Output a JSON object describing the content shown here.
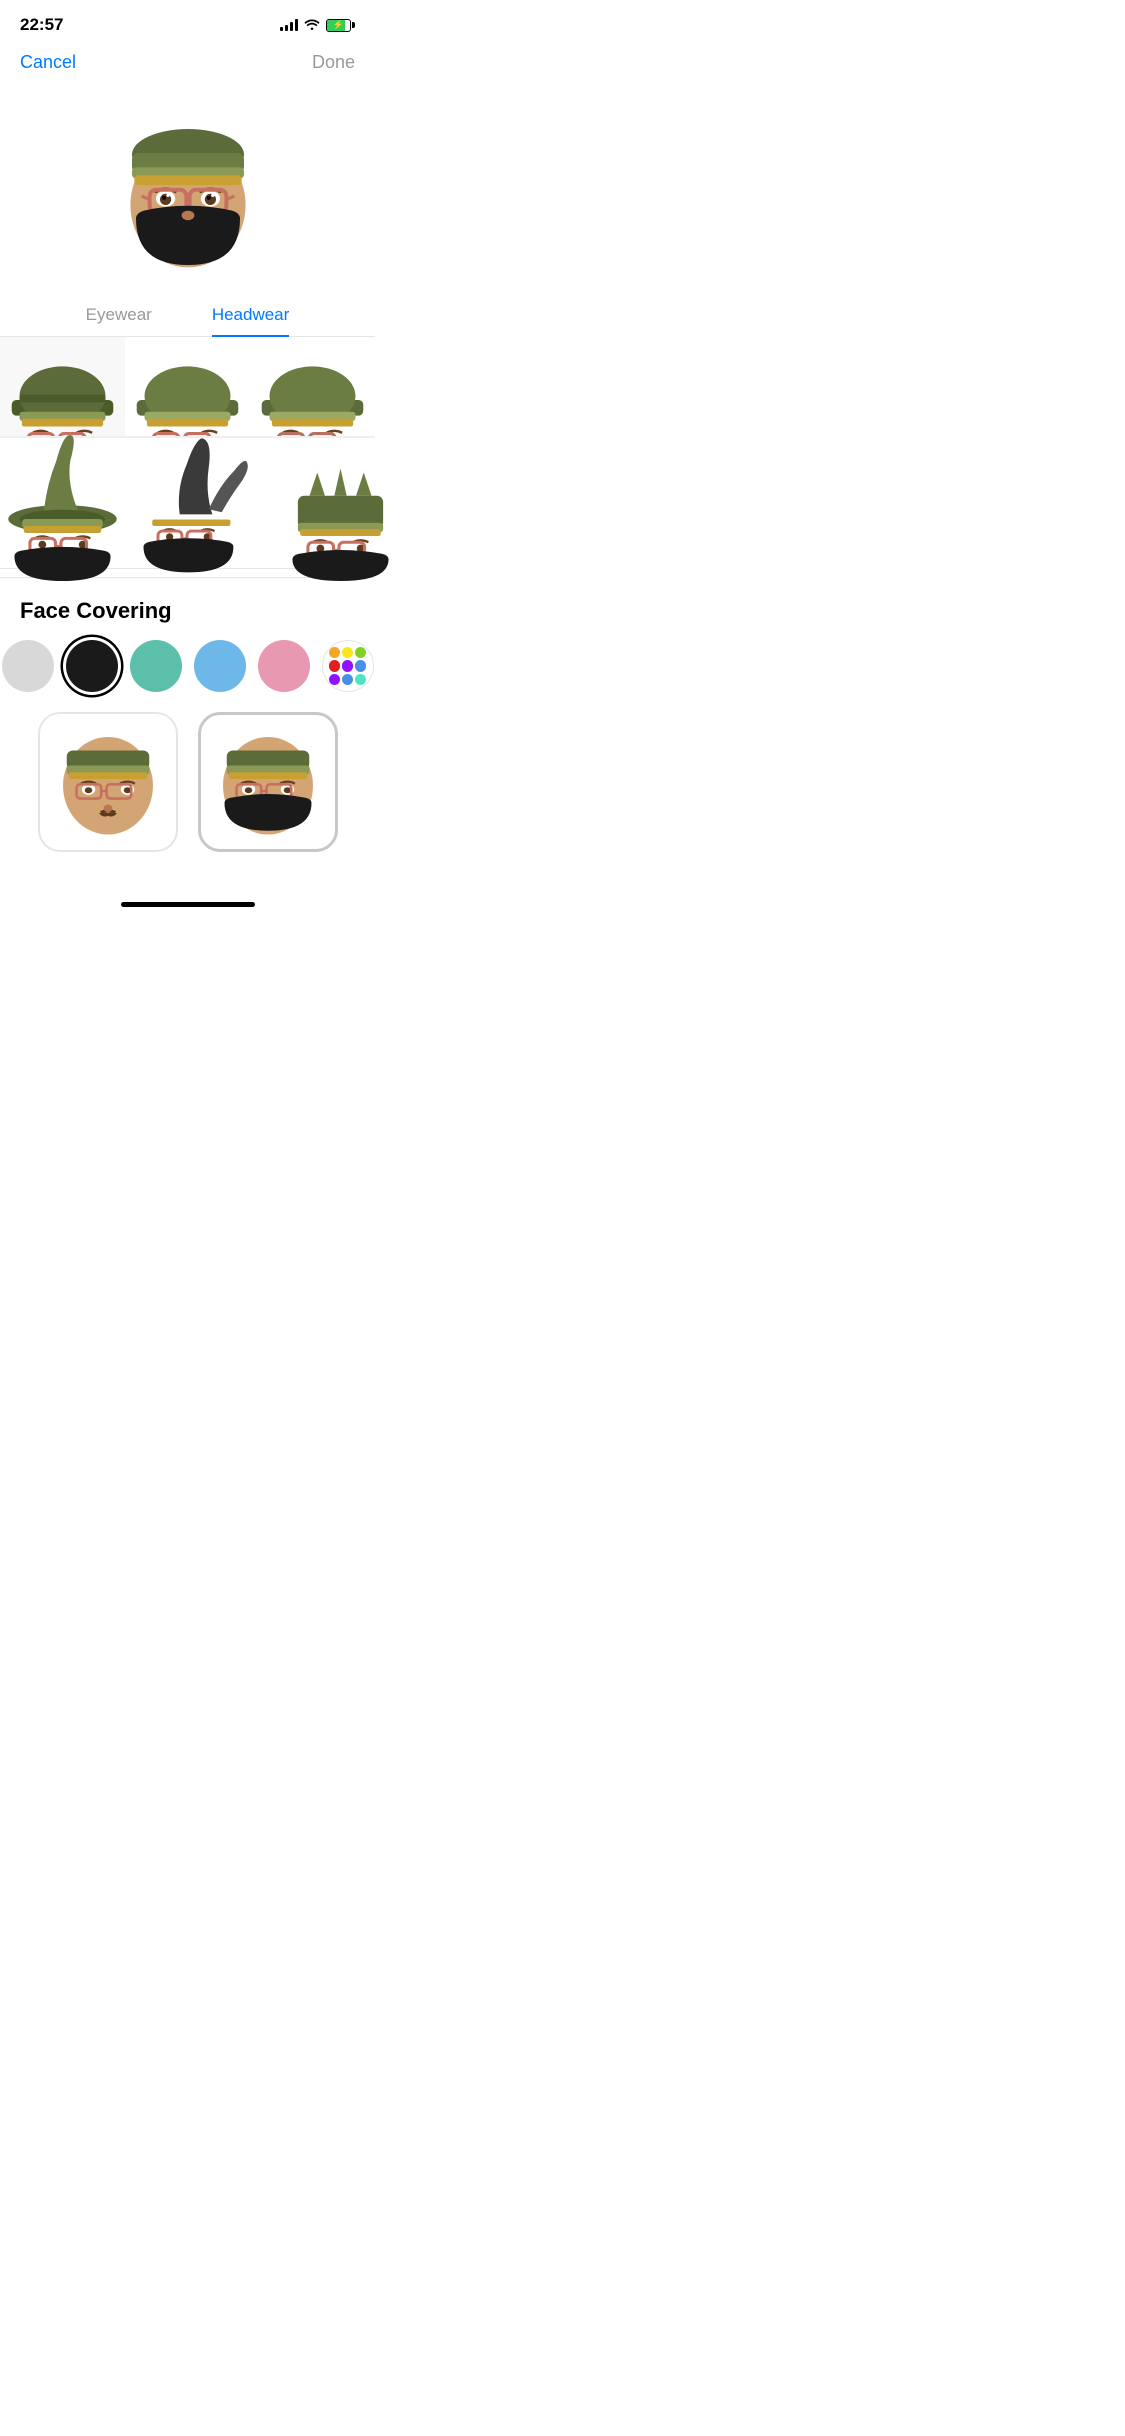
{
  "statusBar": {
    "time": "22:57",
    "greenDot": true
  },
  "nav": {
    "cancelLabel": "Cancel",
    "doneLabel": "Done"
  },
  "segments": {
    "items": [
      {
        "id": "eyewear",
        "label": "Eyewear",
        "active": false
      },
      {
        "id": "headwear",
        "label": "Headwear",
        "active": true
      }
    ]
  },
  "faceCovering": {
    "sectionTitle": "Face Covering",
    "colors": [
      {
        "id": "light-gray",
        "hex": "#d8d8d8",
        "selected": false
      },
      {
        "id": "black",
        "hex": "#1a1a1a",
        "selected": true
      },
      {
        "id": "teal",
        "hex": "#5bbfaa",
        "selected": false
      },
      {
        "id": "light-blue",
        "hex": "#6db8e8",
        "selected": false
      },
      {
        "id": "pink",
        "hex": "#e898b0",
        "selected": false
      },
      {
        "id": "multi",
        "selected": false,
        "dots": [
          "#f5a623",
          "#f8e71c",
          "#7ed321",
          "#e02020",
          "#9013fe",
          "#4a90e2",
          "#50e3c2",
          "#b8e986",
          "#417505"
        ]
      }
    ]
  },
  "homeIndicator": {
    "visible": true
  }
}
